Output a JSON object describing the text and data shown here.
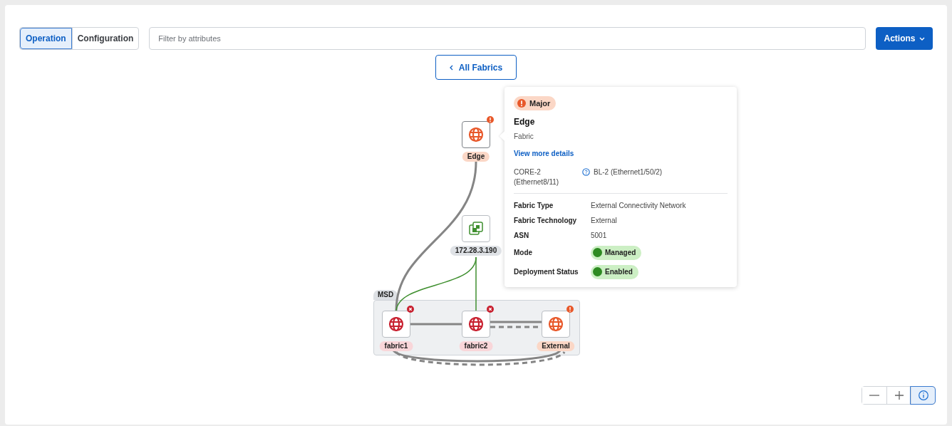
{
  "view_tabs": [
    {
      "label": "Operation",
      "selected": true
    },
    {
      "label": "Configuration",
      "selected": false
    }
  ],
  "filter": {
    "placeholder": "Filter by attributes"
  },
  "actions_button": {
    "label": "Actions"
  },
  "back_button": {
    "label": "All Fabrics"
  },
  "topology": {
    "group": {
      "label": "MSD"
    },
    "nodes": [
      {
        "label": "Edge",
        "kind": "fabric",
        "error": false,
        "warning": true,
        "selected": true
      },
      {
        "label": "172.28.3.190",
        "kind": "vm",
        "error": false,
        "warning": false,
        "selected": false
      },
      {
        "label": "fabric1",
        "kind": "fabric",
        "error": true,
        "warning": false,
        "selected": false
      },
      {
        "label": "fabric2",
        "kind": "fabric",
        "error": true,
        "warning": false,
        "selected": false
      },
      {
        "label": "External",
        "kind": "fabric",
        "error": false,
        "warning": true,
        "selected": false
      }
    ]
  },
  "tooltip": {
    "severity": {
      "label": "Major",
      "warning": true
    },
    "title": "Edge",
    "subtitle": "Fabric",
    "link": "View more details",
    "connection": {
      "local": "CORE-2 (Ethernet8/11)",
      "remote": "BL-2 (Ethernet1/50/2)"
    },
    "properties": [
      {
        "name": "Fabric Type",
        "value": "External Connectivity Network",
        "kind": "text"
      },
      {
        "name": "Fabric Technology",
        "value": "External",
        "kind": "text"
      },
      {
        "name": "ASN",
        "value": "5001",
        "kind": "text"
      },
      {
        "name": "Mode",
        "value": "Managed",
        "kind": "status"
      },
      {
        "name": "Deployment Status",
        "value": "Enabled",
        "kind": "status"
      }
    ]
  },
  "zoom_controls": [
    {
      "kind": "zoom-out",
      "selected": false
    },
    {
      "kind": "zoom-in",
      "selected": false
    },
    {
      "kind": "info",
      "selected": true
    }
  ]
}
